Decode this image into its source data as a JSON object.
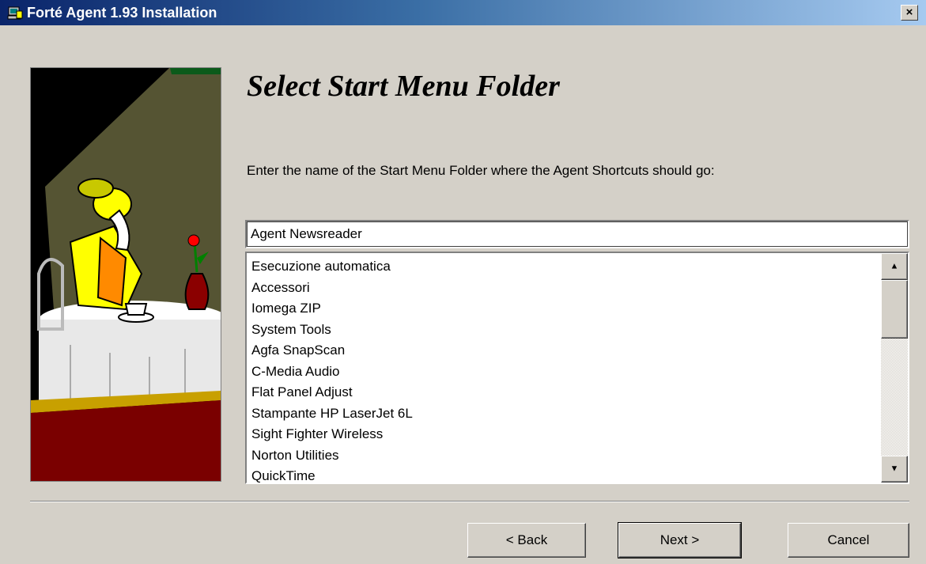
{
  "window": {
    "title": "Forté Agent 1.93 Installation",
    "close_label": "×"
  },
  "page": {
    "heading": "Select Start Menu Folder",
    "instruction": "Enter the name of the Start Menu Folder where the Agent Shortcuts should go:"
  },
  "folder_input": {
    "value": "Agent Newsreader"
  },
  "folder_list": {
    "items": [
      "Esecuzione automatica",
      "Accessori",
      "Iomega ZIP",
      "System Tools",
      "Agfa SnapScan",
      "C-Media Audio",
      "Flat Panel Adjust",
      "Stampante HP LaserJet 6L",
      "Sight Fighter Wireless",
      "Norton Utilities",
      "QuickTime"
    ],
    "scroll_up_icon": "▲",
    "scroll_down_icon": "▼"
  },
  "buttons": {
    "back": "< Back",
    "next": "Next >",
    "cancel": "Cancel"
  },
  "icons": {
    "app": "installer-computer-icon",
    "illustration": "woman-at-cafe-table-illustration"
  },
  "colors": {
    "titlebar_start": "#0a246a",
    "titlebar_end": "#a6caf0",
    "dialog_bg": "#d4d0c8"
  }
}
